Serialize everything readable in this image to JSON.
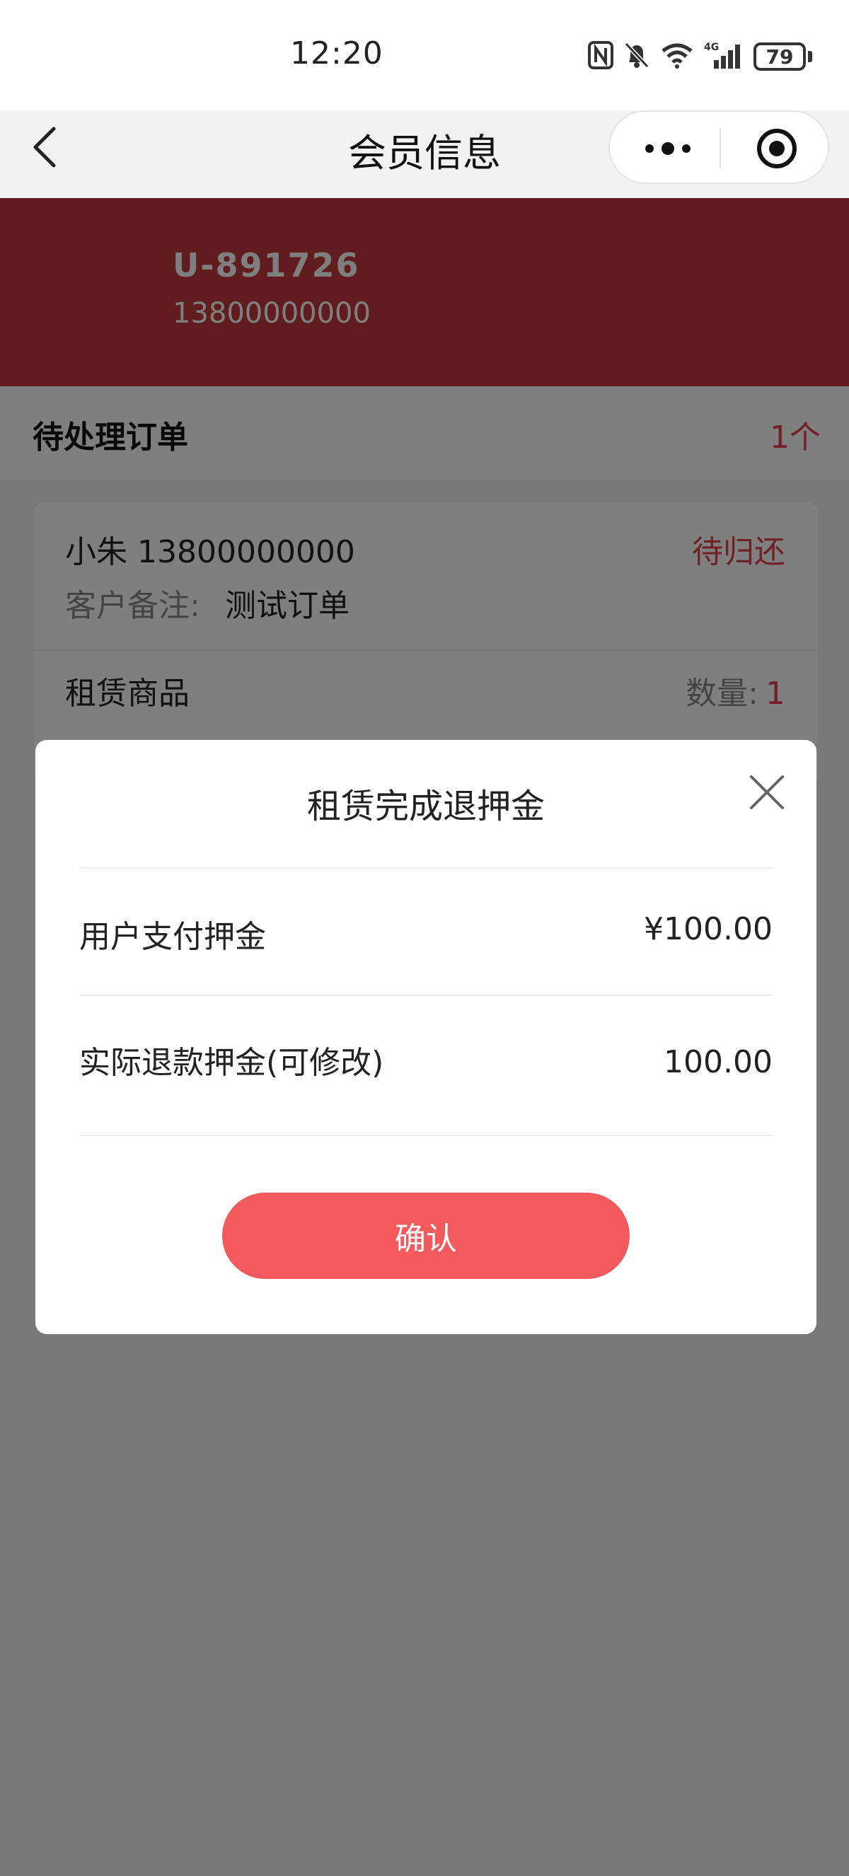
{
  "status_bar": {
    "time": "12:20",
    "network": "4G",
    "battery": "79",
    "icons": [
      "nfc-icon",
      "mute-bell-icon",
      "wifi-icon",
      "signal-icon",
      "battery-icon"
    ]
  },
  "nav": {
    "title": "会员信息",
    "back_icon": "chevron-left-icon",
    "more_icon": "more-dots-icon",
    "close_icon": "target-close-icon"
  },
  "member": {
    "id": "U-891726",
    "phone": "13800000000"
  },
  "pending": {
    "title": "待处理订单",
    "count": "1个"
  },
  "order": {
    "customer": "小朱 13800000000",
    "status": "待归还",
    "note_label": "客户备注:",
    "note_value": "测试订单",
    "goods_label": "租赁商品",
    "qty_label": "数量:",
    "qty_value": "1"
  },
  "dialog": {
    "title": "租赁完成退押金",
    "paid_label": "用户支付押金",
    "paid_value": "¥100.00",
    "refund_label": "实际退款押金(可修改)",
    "refund_value": "100.00",
    "confirm_label": "确认"
  },
  "colors": {
    "brand_red": "#c3383d",
    "accent_red": "#e0434a",
    "button_red": "#f25a5e",
    "mask": "rgba(0,0,0,0.5)"
  }
}
